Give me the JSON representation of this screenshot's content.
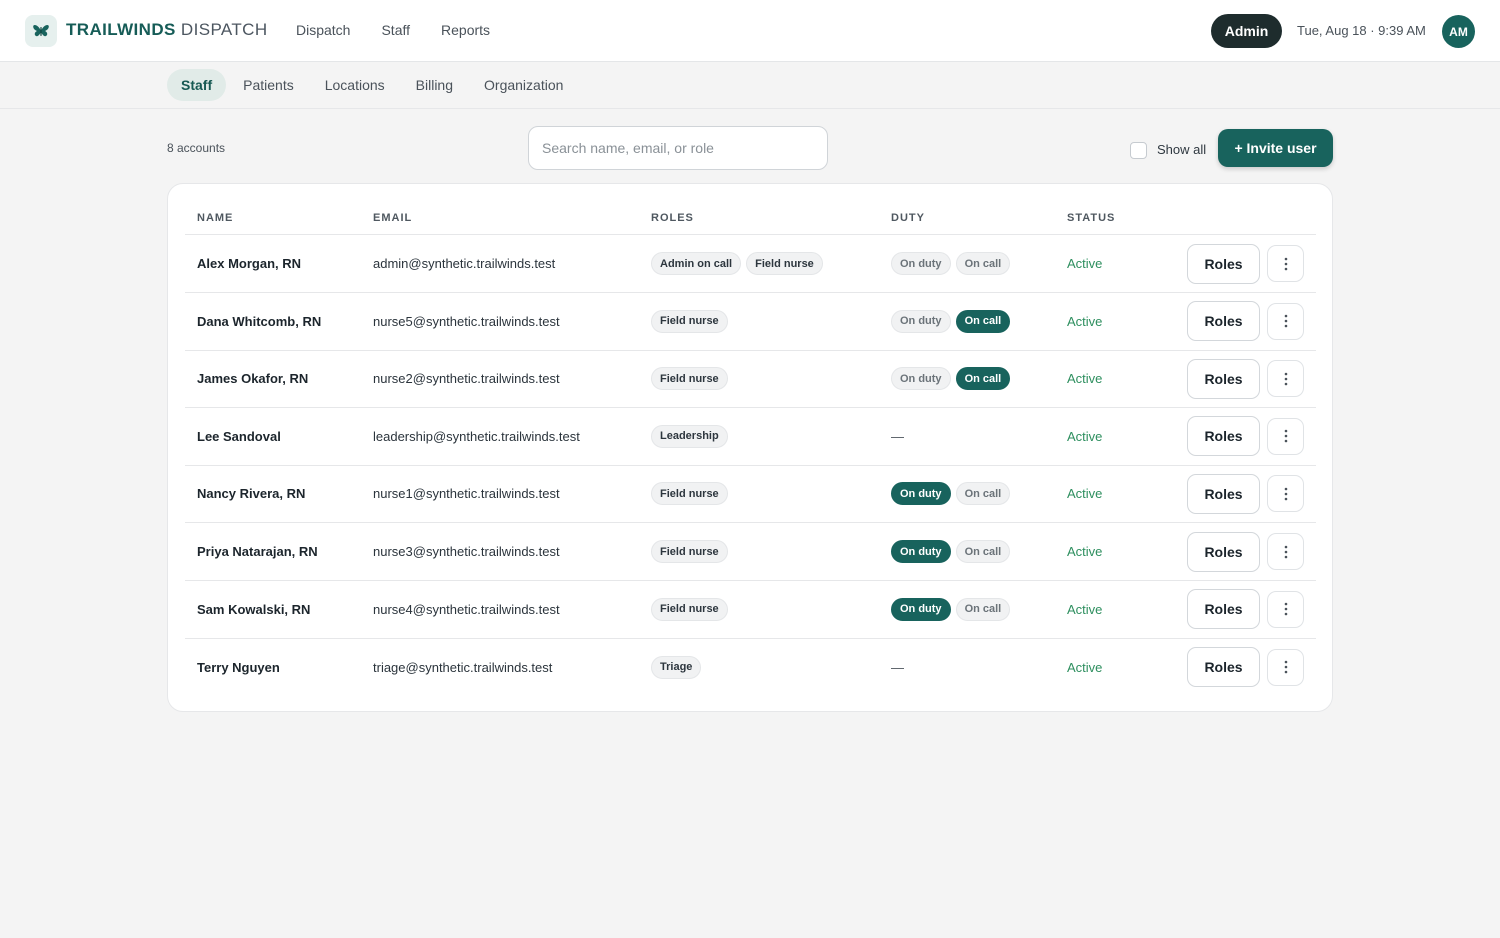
{
  "header": {
    "brand_primary": "TRAILWINDS",
    "brand_secondary": "DISPATCH",
    "nav": [
      "Dispatch",
      "Staff",
      "Reports"
    ],
    "role_badge": "Admin",
    "datetime": "Tue, Aug 18 · 9:39 AM",
    "avatar_initials": "AM"
  },
  "subnav": {
    "tabs": [
      "Staff",
      "Patients",
      "Locations",
      "Billing",
      "Organization"
    ],
    "active": "Staff"
  },
  "toolbar": {
    "count_label": "8 accounts",
    "search_placeholder": "Search name, email, or role",
    "search_value": "",
    "show_all_label": "Show all",
    "show_all_checked": false,
    "invite_label": "+ Invite user"
  },
  "table": {
    "columns": [
      "NAME",
      "EMAIL",
      "ROLES",
      "DUTY",
      "STATUS"
    ],
    "roles_button_label": "Roles",
    "rows": [
      {
        "name": "Alex Morgan, RN",
        "email": "admin@synthetic.trailwinds.test",
        "roles": [
          "Admin on call",
          "Field nurse"
        ],
        "duty": {
          "on_duty_label": "On duty",
          "on_call_label": "On call",
          "on_duty": false,
          "on_call": false
        },
        "status": "Active"
      },
      {
        "name": "Dana Whitcomb, RN",
        "email": "nurse5@synthetic.trailwinds.test",
        "roles": [
          "Field nurse"
        ],
        "duty": {
          "on_duty_label": "On duty",
          "on_call_label": "On call",
          "on_duty": false,
          "on_call": true
        },
        "status": "Active"
      },
      {
        "name": "James Okafor, RN",
        "email": "nurse2@synthetic.trailwinds.test",
        "roles": [
          "Field nurse"
        ],
        "duty": {
          "on_duty_label": "On duty",
          "on_call_label": "On call",
          "on_duty": false,
          "on_call": true
        },
        "status": "Active"
      },
      {
        "name": "Lee Sandoval",
        "email": "leadership@synthetic.trailwinds.test",
        "roles": [
          "Leadership"
        ],
        "duty": null,
        "duty_text": "—",
        "status": "Active"
      },
      {
        "name": "Nancy Rivera, RN",
        "email": "nurse1@synthetic.trailwinds.test",
        "roles": [
          "Field nurse"
        ],
        "duty": {
          "on_duty_label": "On duty",
          "on_call_label": "On call",
          "on_duty": true,
          "on_call": false
        },
        "status": "Active"
      },
      {
        "name": "Priya Natarajan, RN",
        "email": "nurse3@synthetic.trailwinds.test",
        "roles": [
          "Field nurse"
        ],
        "duty": {
          "on_duty_label": "On duty",
          "on_call_label": "On call",
          "on_duty": true,
          "on_call": false
        },
        "status": "Active"
      },
      {
        "name": "Sam Kowalski, RN",
        "email": "nurse4@synthetic.trailwinds.test",
        "roles": [
          "Field nurse"
        ],
        "duty": {
          "on_duty_label": "On duty",
          "on_call_label": "On call",
          "on_duty": true,
          "on_call": false
        },
        "status": "Active"
      },
      {
        "name": "Terry Nguyen",
        "email": "triage@synthetic.trailwinds.test",
        "roles": [
          "Triage"
        ],
        "duty": null,
        "duty_text": "—",
        "status": "Active"
      }
    ]
  },
  "icons": {
    "logo": "butterfly-icon",
    "row_menu": "kebab-menu-icon",
    "checkbox": "checkbox-icon"
  },
  "colors": {
    "brand": "#18635d",
    "status_active": "#2e8f5f",
    "admin_badge": "#1e2c2d"
  }
}
